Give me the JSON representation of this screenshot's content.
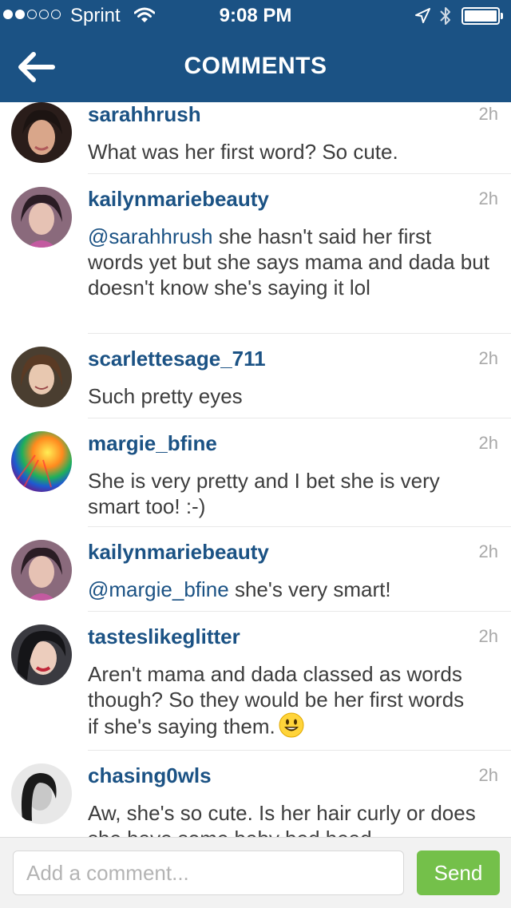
{
  "status_bar": {
    "signal": [
      "full",
      "full",
      "empty",
      "empty",
      "empty"
    ],
    "carrier": "Sprint",
    "time": "9:08 PM",
    "icons": [
      "wifi-icon",
      "location-icon",
      "bluetooth-icon",
      "battery-icon"
    ]
  },
  "nav": {
    "title": "COMMENTS",
    "back_icon": "back-arrow-icon",
    "color": "#1b5284"
  },
  "comments": [
    {
      "user": "sarahhrush",
      "time": "2h",
      "mention": "",
      "text": "What was her first word? So cute."
    },
    {
      "user": "kailynmariebeauty",
      "time": "2h",
      "mention": "@sarahhrush",
      "text": " she hasn't said her first words yet but she says mama and dada but doesn't know she's saying it lol"
    },
    {
      "user": "scarlettesage_711",
      "time": "2h",
      "mention": "",
      "text": "Such pretty eyes"
    },
    {
      "user": "margie_bfine",
      "time": "2h",
      "mention": "",
      "text": "She is very pretty and I bet she is very smart too! :-)"
    },
    {
      "user": "kailynmariebeauty",
      "time": "2h",
      "mention": "@margie_bfine",
      "text": " she's very smart!"
    },
    {
      "user": "tasteslikeglitter",
      "time": "2h",
      "mention": "",
      "text": "Aren't mama and dada classed as words though? So they would be her first words if she's saying them.",
      "emoji": "smiley-emoji-icon"
    },
    {
      "user": "chasing0wls",
      "time": "2h",
      "mention": "",
      "text": "Aw, she's so cute. Is her hair curly or does she have some baby bed head"
    }
  ],
  "composer": {
    "placeholder": "Add a comment...",
    "value": "",
    "send_label": "Send",
    "send_color": "#74c04a"
  }
}
